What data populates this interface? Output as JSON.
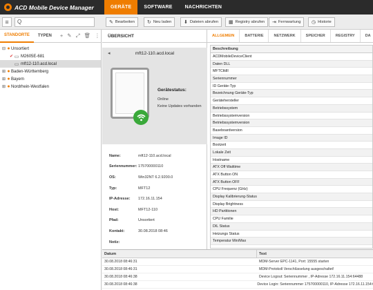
{
  "app": {
    "title": "ACD Mobile Device Manager"
  },
  "nav": {
    "items": [
      "GERÄTE",
      "SOFTWARE",
      "NACHRICHTEN"
    ],
    "active": 0
  },
  "toolbar": {
    "search_value": "Q",
    "buttons": [
      {
        "label": "Bearbeiten",
        "icon": "edit-icon",
        "glyph": "✎"
      },
      {
        "label": "Neu laden",
        "icon": "refresh-icon",
        "glyph": "↻"
      },
      {
        "label": "Dateien abrufen",
        "icon": "file-download-icon",
        "glyph": "⬇"
      },
      {
        "label": "Registry abrufen",
        "icon": "registry-icon",
        "glyph": "▦"
      },
      {
        "label": "Fernwartung",
        "icon": "remote-icon",
        "glyph": "⇥"
      },
      {
        "label": "Historie",
        "icon": "history-icon",
        "glyph": "◷"
      }
    ]
  },
  "left": {
    "tabs": [
      "STANDORTE",
      "TYPEN"
    ],
    "tree": [
      {
        "label": "Unsortiert",
        "level": 0,
        "expand": "⊟"
      },
      {
        "label": "M2605E-681",
        "level": 1
      },
      {
        "label": "mft12-110.acd.local",
        "level": 1,
        "selected": true
      },
      {
        "label": "Baden-Württemberg",
        "level": 0,
        "expand": "⊞"
      },
      {
        "label": "Bayern",
        "level": 0,
        "expand": "⊞"
      },
      {
        "label": "Nordrhein-Westfalen",
        "level": 0,
        "expand": "⊞"
      }
    ]
  },
  "overview": {
    "title": "ÜBERSICHT",
    "device_name": "mft12-110.acd.local",
    "status_label": "Gerätestatus:",
    "status_online": "Online",
    "status_updates": "Keine Updates vorhanden",
    "props": [
      {
        "key": "Name:",
        "value": "mft12-110.acd.local"
      },
      {
        "key": "Seriennummer:",
        "value": "175700000110"
      },
      {
        "key": "OS:",
        "value": "Win32NT 6.2.9200.0"
      },
      {
        "key": "Typ:",
        "value": "MFT12"
      },
      {
        "key": "IP-Adresse:",
        "value": "172.16.11.154"
      },
      {
        "key": "Host:",
        "value": "MFT12-110"
      },
      {
        "key": "Pfad:",
        "value": "Unsortiert"
      },
      {
        "key": "Kontakt:",
        "value": "30.08.2018 08:46"
      },
      {
        "key": "Notiz:",
        "value": ""
      }
    ]
  },
  "details": {
    "tabs": [
      "ALLGEMEIN",
      "BATTERIE",
      "NETZWERK",
      "SPEICHER",
      "REGISTRY",
      "DA"
    ],
    "active_tab": 0,
    "column": "Beschreibung",
    "rows": [
      "ACDMobileDeviceClient",
      "Daten DLL",
      "MFTCtldll",
      "Seriennummer",
      "ID Geräte-Typ",
      "Bezeichnung Geräte-Typ",
      "Gerätehersteller",
      "Betriebssystem",
      "Betriebssystemversion",
      "Betriebssystemversion",
      "Baseboardversion",
      "Image ID",
      "Bootzeit",
      "Lokale Zeit",
      "Hostname",
      "ATX Off Waittime",
      "ATX Button ON",
      "ATX Button OFF",
      "CPU Frequenz (GHz)",
      "Display Kalibrierung-Status",
      "Display Brightness",
      "HD Partitionen",
      "CPU Familie",
      "DIL Status",
      "Heizungs Status",
      "Temperatur Min/Max"
    ]
  },
  "log": {
    "columns": [
      "Datum",
      "Text"
    ],
    "rows": [
      {
        "date": "30.08.2018 08:46:31",
        "text": "MDM-Server EPC-1141, Port: 15555 starten"
      },
      {
        "date": "30.08.2018 08:46:31",
        "text": "MDM-Protokoll Verschlüsselung ausgeschaltet!"
      },
      {
        "date": "30.08.2018 08:46:38",
        "text": "Device Logout: Seriennummer , IP-Adresse 172.16.11.154:64488"
      },
      {
        "date": "30.08.2018 08:46:38",
        "text": "Device Login: Seriennummer 175700000110, IP-Adresse 172.16.11.154:6"
      }
    ]
  },
  "colors": {
    "accent": "#ef7d00",
    "topbar": "#2b2b2b",
    "online": "#3aa93a"
  }
}
